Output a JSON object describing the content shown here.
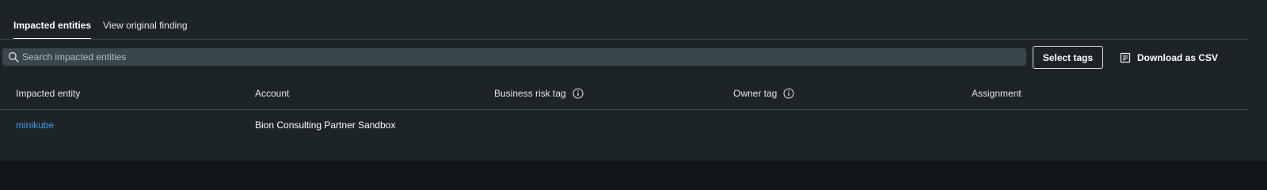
{
  "tabs": [
    {
      "label": "Impacted entities",
      "active": true
    },
    {
      "label": "View original finding",
      "active": false
    }
  ],
  "search": {
    "placeholder": "Search impacted entities",
    "value": ""
  },
  "actions": {
    "select_tags_label": "Select tags",
    "download_label": "Download as CSV"
  },
  "table": {
    "columns": [
      {
        "label": "Impacted entity",
        "info": false
      },
      {
        "label": "Account",
        "info": false
      },
      {
        "label": "Business risk tag",
        "info": true
      },
      {
        "label": "Owner tag",
        "info": true
      },
      {
        "label": "Assignment",
        "info": false
      }
    ],
    "rows": [
      {
        "entity": "minikube",
        "account": "Bion Consulting Partner Sandbox",
        "business_risk_tag": "",
        "owner_tag": "",
        "assignment": ""
      }
    ]
  },
  "colors": {
    "background": "#1c2428",
    "link": "#3e9cf0",
    "search_bg": "#3a464d"
  },
  "icons": {
    "search": "search-icon",
    "download": "download-list-icon",
    "info": "info-icon"
  }
}
